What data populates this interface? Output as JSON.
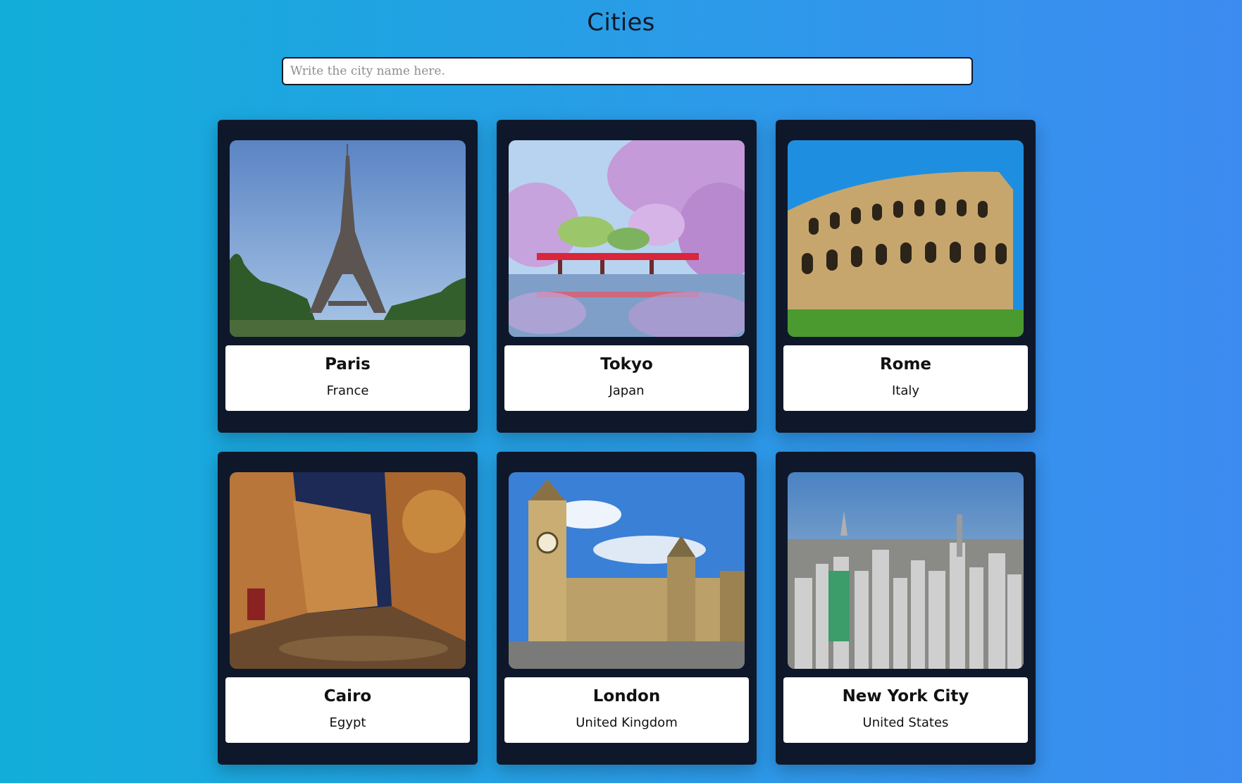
{
  "page": {
    "title": "Cities"
  },
  "search": {
    "placeholder": "Write the city name here."
  },
  "cities": [
    {
      "name": "Paris",
      "country": "France",
      "image": "eiffel-tower-photo"
    },
    {
      "name": "Tokyo",
      "country": "Japan",
      "image": "cherry-blossom-castle-photo"
    },
    {
      "name": "Rome",
      "country": "Italy",
      "image": "colosseum-photo"
    },
    {
      "name": "Cairo",
      "country": "Egypt",
      "image": "old-cairo-street-photo"
    },
    {
      "name": "London",
      "country": "United Kingdom",
      "image": "big-ben-photo"
    },
    {
      "name": "New York City",
      "country": "United States",
      "image": "manhattan-skyline-photo"
    }
  ],
  "colors": {
    "background_start": "#12aed9",
    "background_end": "#3d8bf1",
    "card_background": "#0f172a",
    "info_background": "#ffffff"
  }
}
